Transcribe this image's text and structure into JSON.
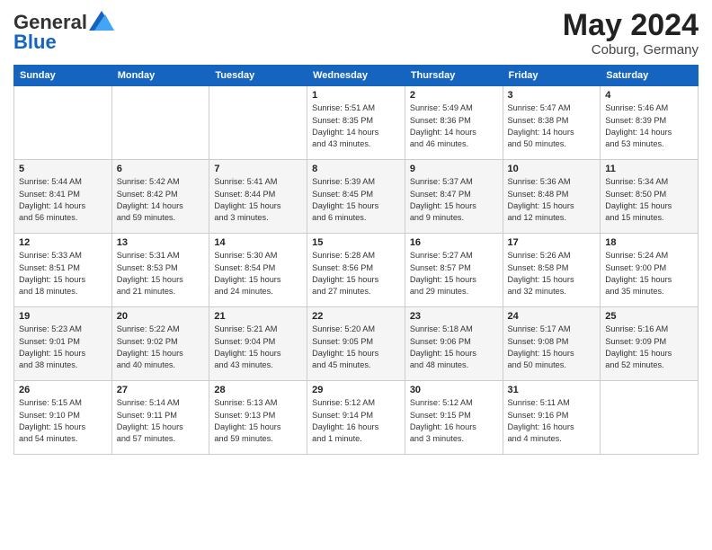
{
  "header": {
    "logo_general": "General",
    "logo_blue": "Blue",
    "month_year": "May 2024",
    "location": "Coburg, Germany"
  },
  "days_of_week": [
    "Sunday",
    "Monday",
    "Tuesday",
    "Wednesday",
    "Thursday",
    "Friday",
    "Saturday"
  ],
  "weeks": [
    [
      {
        "day": "",
        "info": ""
      },
      {
        "day": "",
        "info": ""
      },
      {
        "day": "",
        "info": ""
      },
      {
        "day": "1",
        "info": "Sunrise: 5:51 AM\nSunset: 8:35 PM\nDaylight: 14 hours\nand 43 minutes."
      },
      {
        "day": "2",
        "info": "Sunrise: 5:49 AM\nSunset: 8:36 PM\nDaylight: 14 hours\nand 46 minutes."
      },
      {
        "day": "3",
        "info": "Sunrise: 5:47 AM\nSunset: 8:38 PM\nDaylight: 14 hours\nand 50 minutes."
      },
      {
        "day": "4",
        "info": "Sunrise: 5:46 AM\nSunset: 8:39 PM\nDaylight: 14 hours\nand 53 minutes."
      }
    ],
    [
      {
        "day": "5",
        "info": "Sunrise: 5:44 AM\nSunset: 8:41 PM\nDaylight: 14 hours\nand 56 minutes."
      },
      {
        "day": "6",
        "info": "Sunrise: 5:42 AM\nSunset: 8:42 PM\nDaylight: 14 hours\nand 59 minutes."
      },
      {
        "day": "7",
        "info": "Sunrise: 5:41 AM\nSunset: 8:44 PM\nDaylight: 15 hours\nand 3 minutes."
      },
      {
        "day": "8",
        "info": "Sunrise: 5:39 AM\nSunset: 8:45 PM\nDaylight: 15 hours\nand 6 minutes."
      },
      {
        "day": "9",
        "info": "Sunrise: 5:37 AM\nSunset: 8:47 PM\nDaylight: 15 hours\nand 9 minutes."
      },
      {
        "day": "10",
        "info": "Sunrise: 5:36 AM\nSunset: 8:48 PM\nDaylight: 15 hours\nand 12 minutes."
      },
      {
        "day": "11",
        "info": "Sunrise: 5:34 AM\nSunset: 8:50 PM\nDaylight: 15 hours\nand 15 minutes."
      }
    ],
    [
      {
        "day": "12",
        "info": "Sunrise: 5:33 AM\nSunset: 8:51 PM\nDaylight: 15 hours\nand 18 minutes."
      },
      {
        "day": "13",
        "info": "Sunrise: 5:31 AM\nSunset: 8:53 PM\nDaylight: 15 hours\nand 21 minutes."
      },
      {
        "day": "14",
        "info": "Sunrise: 5:30 AM\nSunset: 8:54 PM\nDaylight: 15 hours\nand 24 minutes."
      },
      {
        "day": "15",
        "info": "Sunrise: 5:28 AM\nSunset: 8:56 PM\nDaylight: 15 hours\nand 27 minutes."
      },
      {
        "day": "16",
        "info": "Sunrise: 5:27 AM\nSunset: 8:57 PM\nDaylight: 15 hours\nand 29 minutes."
      },
      {
        "day": "17",
        "info": "Sunrise: 5:26 AM\nSunset: 8:58 PM\nDaylight: 15 hours\nand 32 minutes."
      },
      {
        "day": "18",
        "info": "Sunrise: 5:24 AM\nSunset: 9:00 PM\nDaylight: 15 hours\nand 35 minutes."
      }
    ],
    [
      {
        "day": "19",
        "info": "Sunrise: 5:23 AM\nSunset: 9:01 PM\nDaylight: 15 hours\nand 38 minutes."
      },
      {
        "day": "20",
        "info": "Sunrise: 5:22 AM\nSunset: 9:02 PM\nDaylight: 15 hours\nand 40 minutes."
      },
      {
        "day": "21",
        "info": "Sunrise: 5:21 AM\nSunset: 9:04 PM\nDaylight: 15 hours\nand 43 minutes."
      },
      {
        "day": "22",
        "info": "Sunrise: 5:20 AM\nSunset: 9:05 PM\nDaylight: 15 hours\nand 45 minutes."
      },
      {
        "day": "23",
        "info": "Sunrise: 5:18 AM\nSunset: 9:06 PM\nDaylight: 15 hours\nand 48 minutes."
      },
      {
        "day": "24",
        "info": "Sunrise: 5:17 AM\nSunset: 9:08 PM\nDaylight: 15 hours\nand 50 minutes."
      },
      {
        "day": "25",
        "info": "Sunrise: 5:16 AM\nSunset: 9:09 PM\nDaylight: 15 hours\nand 52 minutes."
      }
    ],
    [
      {
        "day": "26",
        "info": "Sunrise: 5:15 AM\nSunset: 9:10 PM\nDaylight: 15 hours\nand 54 minutes."
      },
      {
        "day": "27",
        "info": "Sunrise: 5:14 AM\nSunset: 9:11 PM\nDaylight: 15 hours\nand 57 minutes."
      },
      {
        "day": "28",
        "info": "Sunrise: 5:13 AM\nSunset: 9:13 PM\nDaylight: 15 hours\nand 59 minutes."
      },
      {
        "day": "29",
        "info": "Sunrise: 5:12 AM\nSunset: 9:14 PM\nDaylight: 16 hours\nand 1 minute."
      },
      {
        "day": "30",
        "info": "Sunrise: 5:12 AM\nSunset: 9:15 PM\nDaylight: 16 hours\nand 3 minutes."
      },
      {
        "day": "31",
        "info": "Sunrise: 5:11 AM\nSunset: 9:16 PM\nDaylight: 16 hours\nand 4 minutes."
      },
      {
        "day": "",
        "info": ""
      }
    ]
  ]
}
